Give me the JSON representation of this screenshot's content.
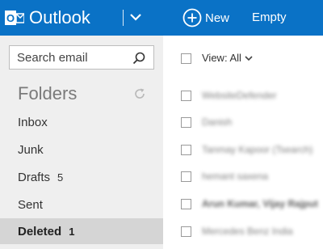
{
  "header": {
    "brand": "Outlook",
    "new_label": "New",
    "empty_label": "Empty",
    "brand_color": "#0a72c6"
  },
  "search": {
    "placeholder": "Search email"
  },
  "folders": {
    "title": "Folders",
    "items": [
      {
        "label": "Inbox",
        "count": ""
      },
      {
        "label": "Junk",
        "count": ""
      },
      {
        "label": "Drafts",
        "count": "5"
      },
      {
        "label": "Sent",
        "count": ""
      },
      {
        "label": "Deleted",
        "count": "1",
        "active": true
      }
    ]
  },
  "messages": {
    "view_label": "View: All",
    "rows": [
      {
        "sender": "WebsiteDefender"
      },
      {
        "sender": "Danish"
      },
      {
        "sender": "Tanmay Kapoor (Tsearch)"
      },
      {
        "sender": "hemant saxena"
      },
      {
        "sender": "Arun Kumar, Vijay Rajput",
        "unread": true
      },
      {
        "sender": "Mercedes Benz India"
      }
    ]
  }
}
